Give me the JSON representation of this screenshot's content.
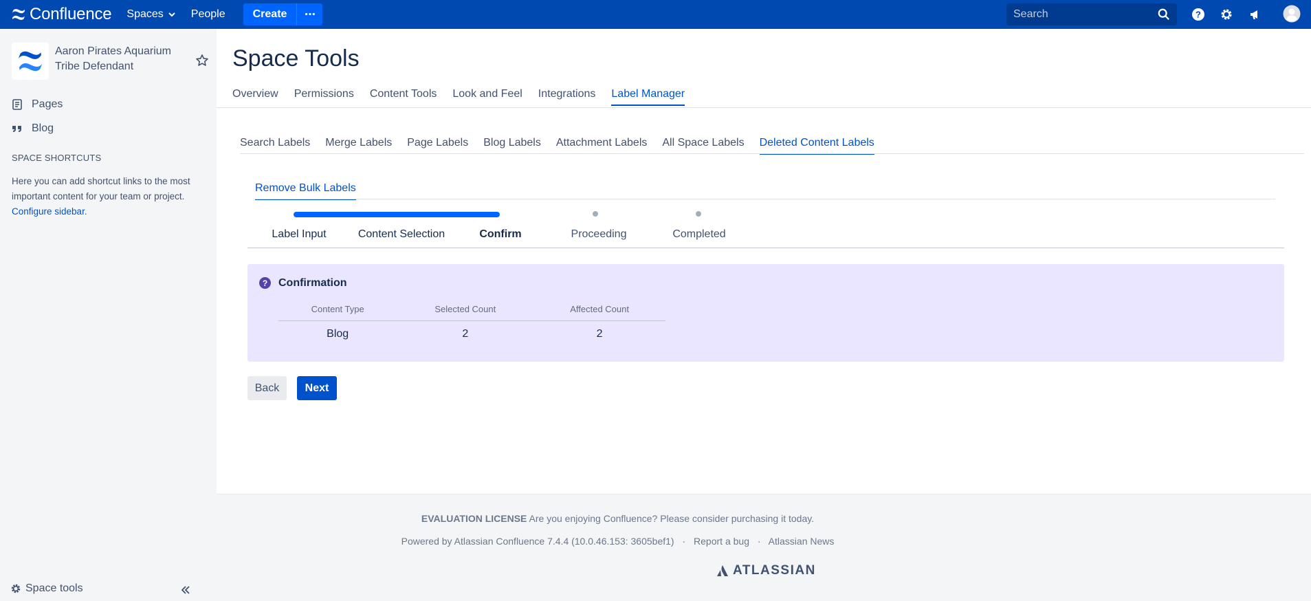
{
  "topbar": {
    "brand": "Confluence",
    "spaces_label": "Spaces",
    "people_label": "People",
    "create_label": "Create",
    "more_label": "⋯",
    "search_placeholder": "Search"
  },
  "sidebar": {
    "space_name": "Aaron Pirates Aquarium Tribe Defendant",
    "pages_label": "Pages",
    "blog_label": "Blog",
    "shortcuts_title": "SPACE SHORTCUTS",
    "shortcuts_text": "Here you can add shortcut links to the most important content for your team or project.",
    "configure_link": "Configure sidebar",
    "configure_suffix": ".",
    "space_tools_label": "Space tools"
  },
  "main": {
    "title": "Space Tools",
    "tabs": [
      {
        "label": "Overview"
      },
      {
        "label": "Permissions"
      },
      {
        "label": "Content Tools"
      },
      {
        "label": "Look and Feel"
      },
      {
        "label": "Integrations"
      },
      {
        "label": "Label Manager"
      }
    ],
    "subtabs": [
      {
        "label": "Search Labels"
      },
      {
        "label": "Merge Labels"
      },
      {
        "label": "Page Labels"
      },
      {
        "label": "Blog Labels"
      },
      {
        "label": "Attachment Labels"
      },
      {
        "label": "All Space Labels"
      },
      {
        "label": "Deleted Content Labels"
      }
    ],
    "section_tab": "Remove Bulk Labels",
    "steps": [
      {
        "label": "Label Input"
      },
      {
        "label": "Content Selection"
      },
      {
        "label": "Confirm"
      },
      {
        "label": "Proceeding"
      },
      {
        "label": "Completed"
      }
    ],
    "confirmation": {
      "title": "Confirmation",
      "headers": [
        "Content Type",
        "Selected Count",
        "Affected Count"
      ],
      "rows": [
        [
          "Blog",
          "2",
          "2"
        ]
      ]
    },
    "back_label": "Back",
    "next_label": "Next"
  },
  "footer": {
    "license_bold": "EVALUATION LICENSE",
    "license_text": " Are you enjoying Confluence? Please consider purchasing it today.",
    "powered_by": "Powered by Atlassian Confluence 7.4.4 (10.0.46.153: 3605bef1)",
    "separator": "·",
    "report_bug": "Report a bug",
    "news": "Atlassian News",
    "atlassian_logo_text": "ATLASSIAN"
  },
  "colors": {
    "topbar": "#0049b0",
    "accent": "#0052cc",
    "panel": "#eae6ff",
    "sidebar": "#f4f5f7"
  }
}
